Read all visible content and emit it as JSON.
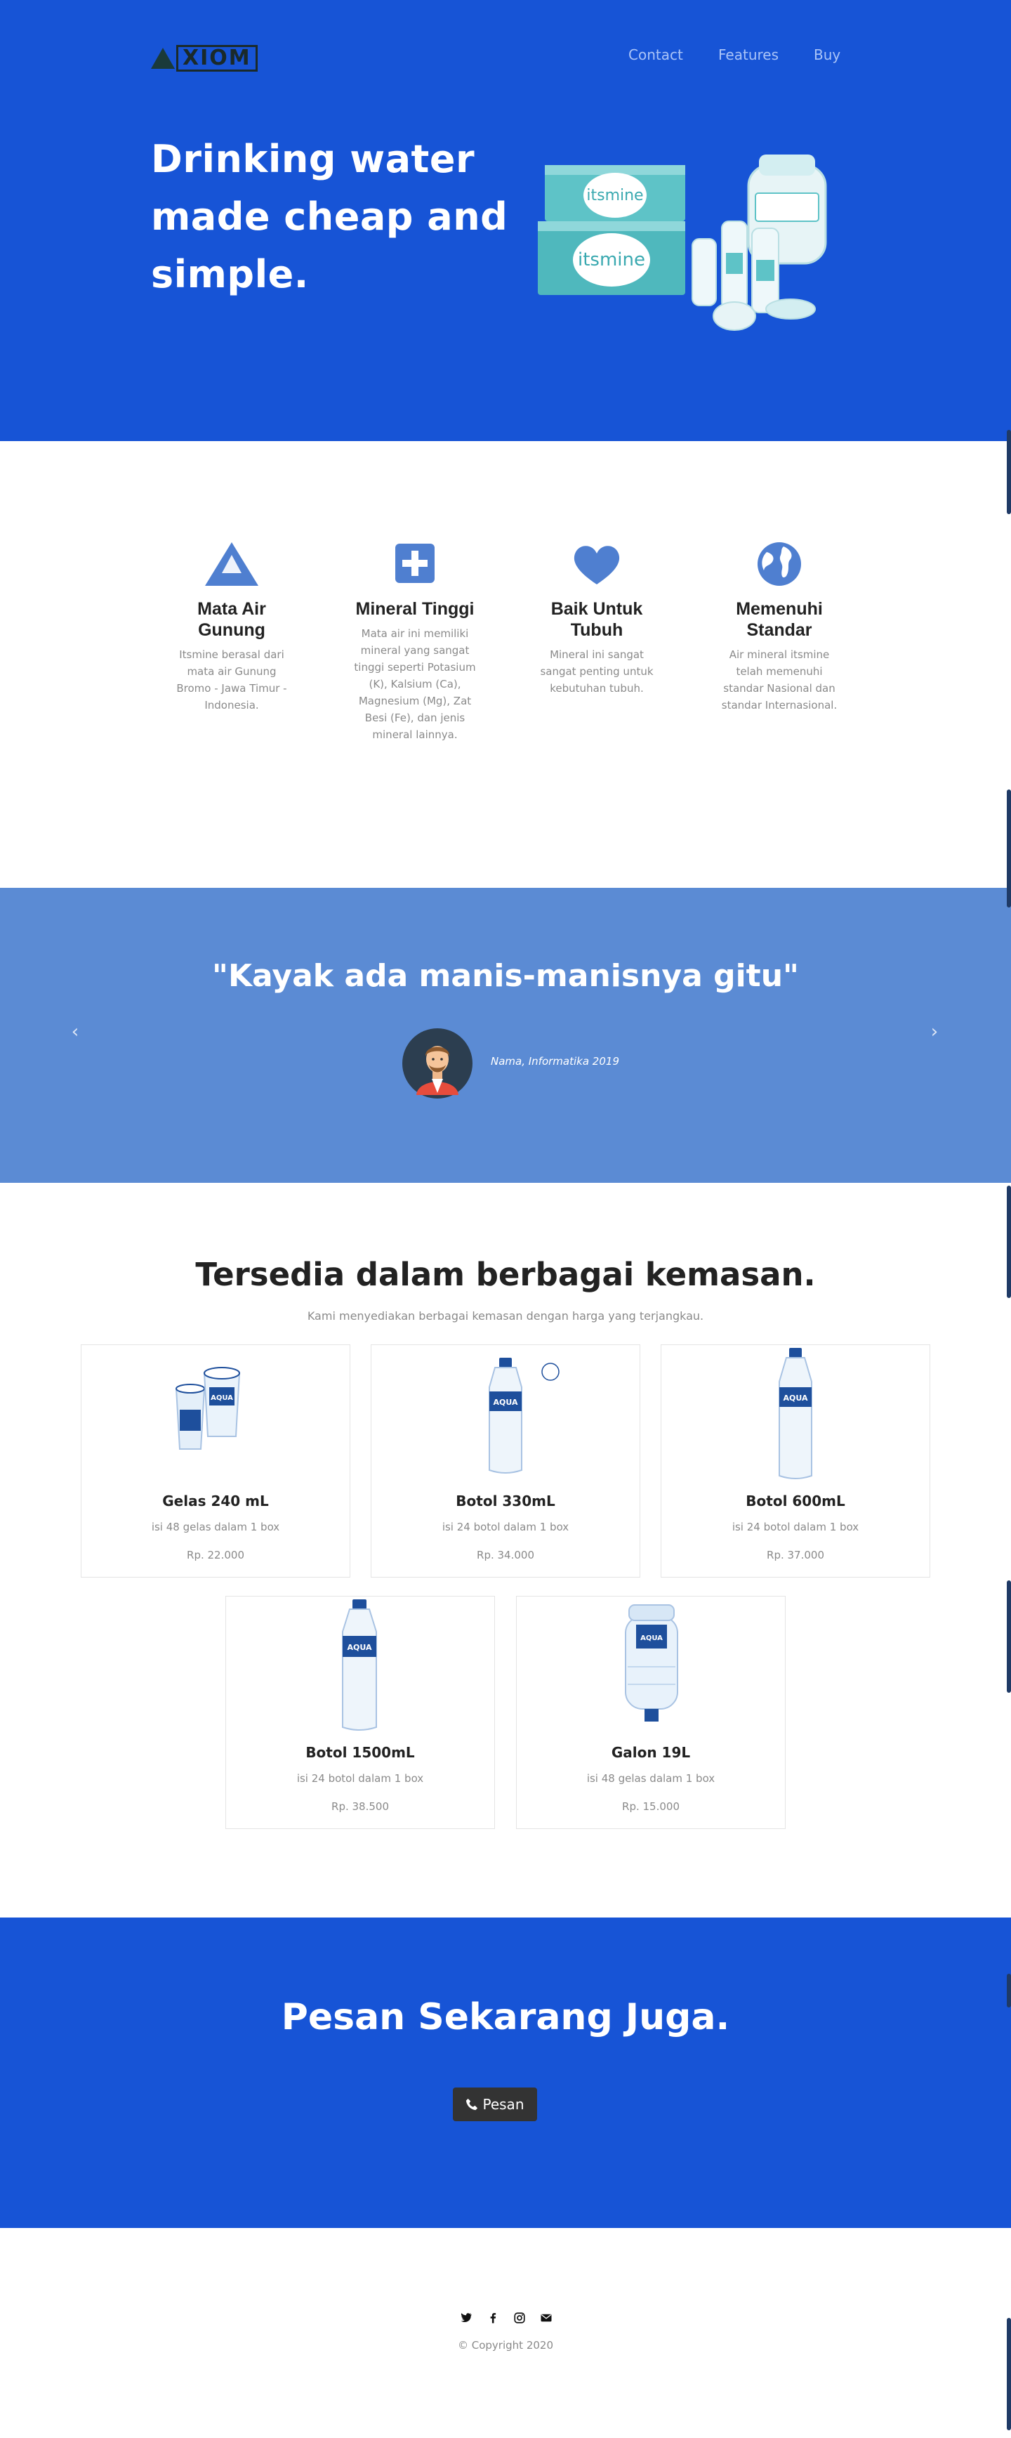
{
  "header": {
    "logo_text": "XIOM",
    "nav": [
      "Contact",
      "Features",
      "Buy"
    ]
  },
  "hero": {
    "title": "Drinking water made cheap and simple.",
    "image_label": "itsmine"
  },
  "features": [
    {
      "icon": "mountain-icon",
      "title": "Mata Air Gunung",
      "text": "Itsmine berasal dari mata air Gunung Bromo - Jawa Timur - Indonesia."
    },
    {
      "icon": "plus-square-icon",
      "title": "Mineral Tinggi",
      "text": "Mata air ini memiliki mineral yang sangat tinggi seperti Potasium (K), Kalsium (Ca), Magnesium (Mg), Zat Besi (Fe), dan jenis mineral lainnya."
    },
    {
      "icon": "heart-icon",
      "title": "Baik Untuk Tubuh",
      "text": "Mineral ini sangat sangat penting untuk kebutuhan tubuh."
    },
    {
      "icon": "globe-icon",
      "title": "Memenuhi Standar",
      "text": "Air mineral itsmine telah memenuhi standar Nasional dan standar Internasional."
    }
  ],
  "testimonial": {
    "quote": "\"Kayak ada manis-manisnya gitu\"",
    "person": "Nama, Informatika 2019"
  },
  "products": {
    "title": "Tersedia dalam berbagai kemasan.",
    "subtitle": "Kami menyediakan berbagai kemasan dengan harga yang terjangkau.",
    "items": [
      {
        "name": "Gelas 240 mL",
        "desc": "isi 48 gelas dalam 1 box",
        "price": "Rp. 22.000",
        "brand": "AQUA"
      },
      {
        "name": "Botol 330mL",
        "desc": "isi 24 botol dalam 1 box",
        "price": "Rp. 34.000",
        "brand": "AQUA"
      },
      {
        "name": "Botol 600mL",
        "desc": "isi 24 botol dalam 1 box",
        "price": "Rp. 37.000",
        "brand": "AQUA"
      },
      {
        "name": "Botol 1500mL",
        "desc": "isi 24 botol dalam 1 box",
        "price": "Rp. 38.500",
        "brand": "AQUA"
      },
      {
        "name": "Galon 19L",
        "desc": "isi 48 gelas dalam 1 box",
        "price": "Rp. 15.000",
        "brand": "AQUA"
      }
    ]
  },
  "cta": {
    "title": "Pesan Sekarang Juga.",
    "button": "Pesan"
  },
  "footer": {
    "socials": [
      "twitter-icon",
      "facebook-icon",
      "instagram-icon",
      "envelope-icon"
    ],
    "copyright": "© Copyright 2020"
  },
  "colors": {
    "hero_bg": "#1754d6",
    "testimonial_bg": "#5b8bd4",
    "feature_icon": "#4f7fd0",
    "button_bg": "#333333"
  }
}
